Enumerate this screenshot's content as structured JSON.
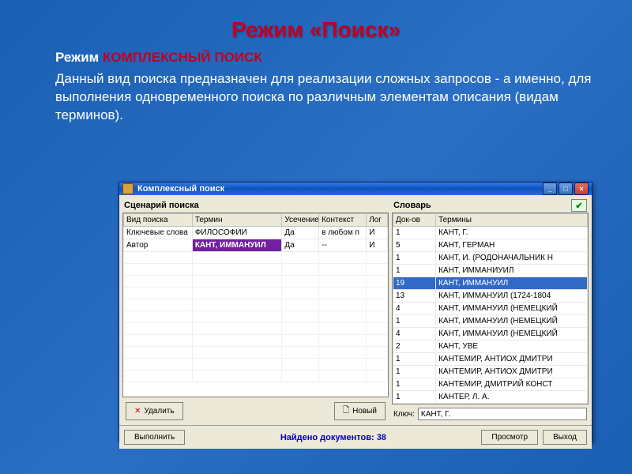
{
  "slide": {
    "title": "Режим  «Поиск»",
    "mode_label": "Режим ",
    "mode_name": "КОМПЛЕКСНЫЙ ПОИСК",
    "description": "Данный вид поиска предназначен для реализации сложных запросов - а именно, для выполнения одновременного поиска по различным элементам описания (видам терминов)."
  },
  "window": {
    "title": "Комплексный поиск",
    "left": {
      "group_title": "Сценарий поиска",
      "columns": [
        "Вид поиска",
        "Термин",
        "Усечение",
        "Контекст",
        "Лог"
      ],
      "rows": [
        {
          "c0": "Ключевые слова",
          "c1": "ФИЛОСОФИИ",
          "c2": "Да",
          "c3": "в любом п",
          "c4": "И",
          "hl": false
        },
        {
          "c0": "Автор",
          "c1": "КАНТ, ИММАНУИЛ",
          "c2": "Да",
          "c3": "--",
          "c4": "И",
          "hl": true
        }
      ],
      "btn_delete": "Удалить",
      "btn_new": "Новый"
    },
    "right": {
      "group_title": "Словарь",
      "columns": [
        "Док-ов",
        "Термины"
      ],
      "rows": [
        {
          "n": "1",
          "t": "КАНТ, Г."
        },
        {
          "n": "5",
          "t": "КАНТ, ГЕРМАН"
        },
        {
          "n": "1",
          "t": "КАНТ, И. (РОДОНАЧАЛЬНИК Н"
        },
        {
          "n": "1",
          "t": "КАНТ, ИММАНИУИЛ"
        },
        {
          "n": "19",
          "t": "КАНТ, ИММАНУИЛ"
        },
        {
          "n": "13",
          "t": "КАНТ, ИММАНУИЛ (1724-1804"
        },
        {
          "n": "4",
          "t": "КАНТ, ИММАНУИЛ (НЕМЕЦКИЙ"
        },
        {
          "n": "1",
          "t": "КАНТ, ИММАНУИЛ (НЕМЕЦКИЙ"
        },
        {
          "n": "4",
          "t": "КАНТ, ИММАНУИЛ (НЕМЕЦКИЙ"
        },
        {
          "n": "2",
          "t": "КАНТ, УВЕ"
        },
        {
          "n": "1",
          "t": "КАНТЕМИР, АНТИОХ ДМИТРИ"
        },
        {
          "n": "1",
          "t": "КАНТЕМИР, АНТИОХ ДМИТРИ"
        },
        {
          "n": "1",
          "t": "КАНТЕМИР, ДМИТРИЙ КОНСТ"
        },
        {
          "n": "1",
          "t": "КАНТЕР, Л. А."
        }
      ],
      "selected_index": 4,
      "key_label": "Ключ:",
      "key_value": "КАНТ, Г."
    },
    "footer": {
      "btn_execute": "Выполнить",
      "found_text": "Найдено документов: 38",
      "btn_view": "Просмотр",
      "btn_exit": "Выход"
    }
  }
}
